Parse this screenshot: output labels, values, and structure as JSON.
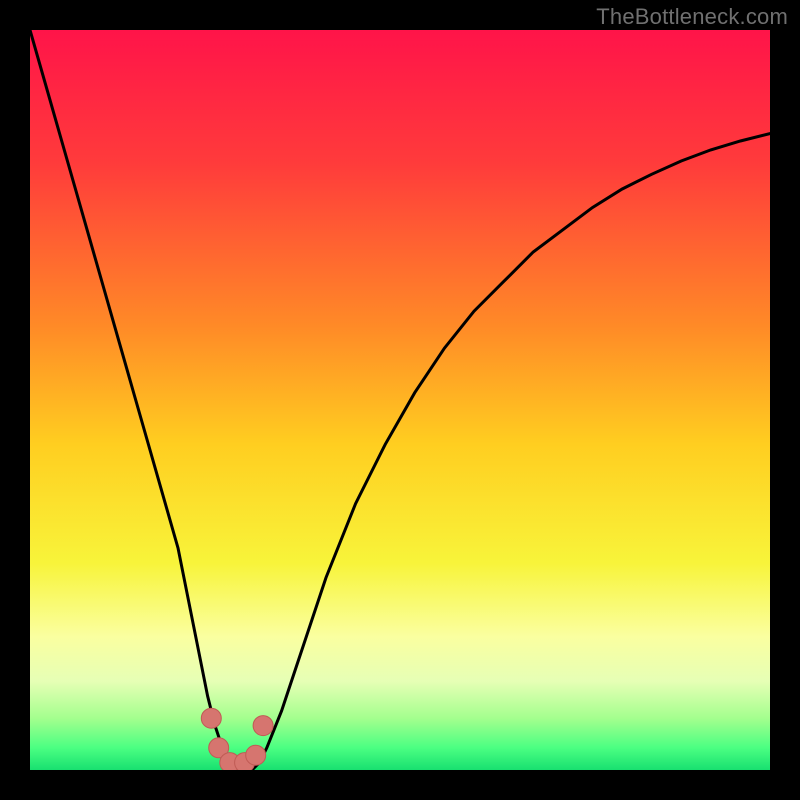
{
  "watermark": "TheBottleneck.com",
  "colors": {
    "gradient_stops": [
      {
        "offset": 0.0,
        "color": "#ff1449"
      },
      {
        "offset": 0.18,
        "color": "#ff3b3b"
      },
      {
        "offset": 0.4,
        "color": "#ff8a27"
      },
      {
        "offset": 0.56,
        "color": "#ffce20"
      },
      {
        "offset": 0.72,
        "color": "#f8f43a"
      },
      {
        "offset": 0.82,
        "color": "#faffa0"
      },
      {
        "offset": 0.88,
        "color": "#e6ffb5"
      },
      {
        "offset": 0.93,
        "color": "#a4ff8e"
      },
      {
        "offset": 0.97,
        "color": "#4bff82"
      },
      {
        "offset": 1.0,
        "color": "#18e070"
      }
    ],
    "curve": "#000000",
    "marker_fill": "#d6756f",
    "marker_stroke": "#c05b55"
  },
  "chart_data": {
    "type": "line",
    "title": "",
    "xlabel": "",
    "ylabel": "",
    "xlim": [
      0,
      100
    ],
    "ylim": [
      0,
      100
    ],
    "series": [
      {
        "name": "bottleneck-curve",
        "x": [
          0,
          2,
          4,
          6,
          8,
          10,
          12,
          14,
          16,
          18,
          20,
          22,
          23,
          24,
          25,
          26,
          27,
          28,
          29,
          30,
          31,
          32,
          34,
          36,
          38,
          40,
          44,
          48,
          52,
          56,
          60,
          64,
          68,
          72,
          76,
          80,
          84,
          88,
          92,
          96,
          100
        ],
        "y": [
          100,
          93,
          86,
          79,
          72,
          65,
          58,
          51,
          44,
          37,
          30,
          20,
          15,
          10,
          6,
          3,
          1,
          0,
          0,
          0,
          1,
          3,
          8,
          14,
          20,
          26,
          36,
          44,
          51,
          57,
          62,
          66,
          70,
          73,
          76,
          78.5,
          80.5,
          82.3,
          83.8,
          85,
          86
        ]
      }
    ],
    "markers": [
      {
        "name": "point-a",
        "x": 24.5,
        "y": 7
      },
      {
        "name": "point-b",
        "x": 25.5,
        "y": 3
      },
      {
        "name": "point-c",
        "x": 27.0,
        "y": 1
      },
      {
        "name": "point-d",
        "x": 29.0,
        "y": 1
      },
      {
        "name": "point-e",
        "x": 30.5,
        "y": 2
      },
      {
        "name": "point-f",
        "x": 31.5,
        "y": 6
      }
    ],
    "marker_radius_px": 10
  }
}
